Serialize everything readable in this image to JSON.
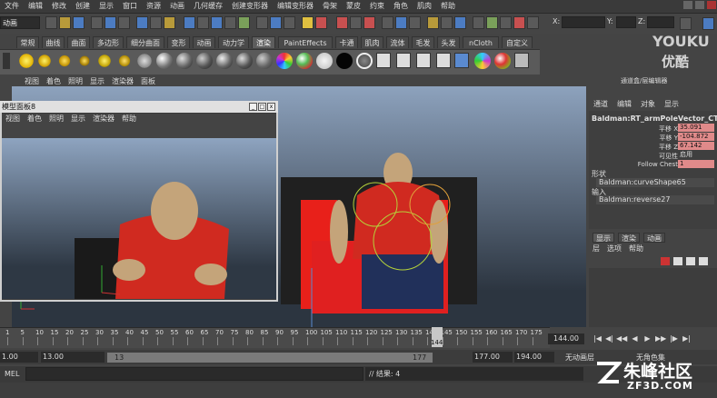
{
  "menubar": {
    "items": [
      "文件",
      "编辑",
      "修改",
      "创建",
      "显示",
      "窗口",
      "资源",
      "动画",
      "几何缓存",
      "创建变形器",
      "编辑变形器",
      "骨架",
      "蒙皮",
      "约束",
      "角色",
      "肌肉",
      "帮助"
    ]
  },
  "statusline": {
    "mode": "动画",
    "x_label": "X:",
    "y_label": "Y:",
    "z_label": "Z:"
  },
  "shelf": {
    "tabs": [
      "常规",
      "曲线",
      "曲面",
      "多边形",
      "细分曲面",
      "变形",
      "动画",
      "动力学",
      "渲染",
      "PaintEffects",
      "卡通",
      "肌肉",
      "流体",
      "毛发",
      "头发",
      "nCloth",
      "自定义"
    ],
    "active_tab": "渲染"
  },
  "logo": {
    "name": "YOUKU",
    "sub": "优酷"
  },
  "viewport": {
    "menus": [
      "视图",
      "着色",
      "照明",
      "显示",
      "渲染器",
      "面板"
    ]
  },
  "float_panel": {
    "title": "模型面板8",
    "menus": [
      "视图",
      "着色",
      "照明",
      "显示",
      "渲染器",
      "帮助"
    ]
  },
  "channel_box": {
    "header": "通道盒/层编辑器",
    "menus": [
      "通道",
      "编辑",
      "对象",
      "显示"
    ],
    "object": "Baldman:RT_armPoleVector_CTRL",
    "attributes": [
      {
        "label": "平移 X",
        "value": "35.091",
        "highlight": true
      },
      {
        "label": "平移 Y",
        "value": "-104.872",
        "highlight": true
      },
      {
        "label": "平移 Z",
        "value": "67.142",
        "highlight": true
      },
      {
        "label": "可见性",
        "value": "启用",
        "highlight": false
      },
      {
        "label": "Follow Chest",
        "value": "1",
        "highlight": true
      }
    ],
    "shapes_header": "形状",
    "shape_item": "Baldman:curveShape65",
    "inputs_header": "输入",
    "input_item": "Baldman:reverse27"
  },
  "layer_editor": {
    "tabs": [
      "显示",
      "渲染",
      "动画"
    ],
    "menus": [
      "层",
      "选项",
      "帮助"
    ]
  },
  "timeline": {
    "ticks": [
      "1",
      "5",
      "10",
      "15",
      "20",
      "25",
      "30",
      "35",
      "40",
      "45",
      "50",
      "55",
      "60",
      "65",
      "70",
      "75",
      "80",
      "85",
      "90",
      "95",
      "100",
      "105",
      "110",
      "115",
      "120",
      "125",
      "130",
      "135",
      "140",
      "145",
      "150",
      "155",
      "160",
      "165",
      "170",
      "175"
    ],
    "current_frame": "144.00",
    "current_marker": "144"
  },
  "range": {
    "start": "1.00",
    "inner_start": "13.00",
    "slider_start": "13",
    "slider_end": "177",
    "inner_end": "177.00",
    "end": "194.00",
    "anim_layer": "无动画层",
    "char_set": "无角色集"
  },
  "cmdline": {
    "label": "MEL",
    "result": "// 结果: 4"
  },
  "watermark": {
    "cn": "朱峰社区",
    "en": "ZF3D.COM"
  },
  "colors": {
    "attr_highlight": "#e08a8a",
    "bg": "#444444"
  }
}
